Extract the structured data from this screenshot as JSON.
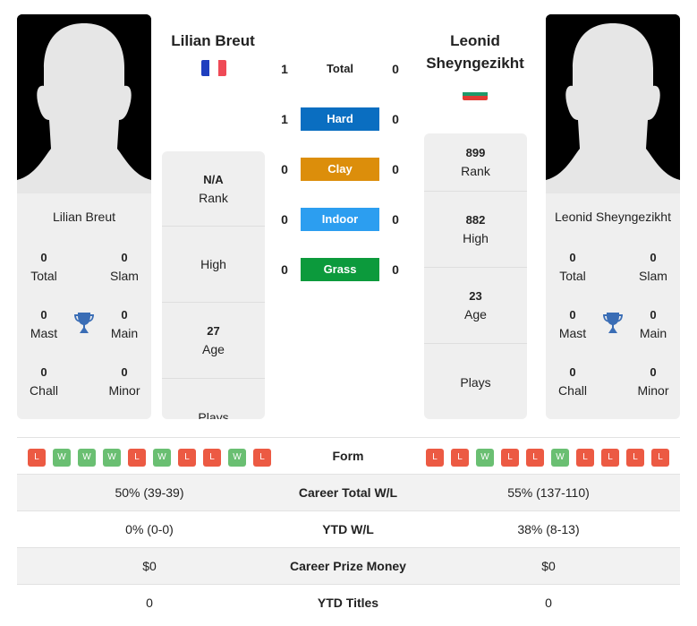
{
  "players": {
    "left": {
      "name": "Lilian Breut",
      "card_name": "Lilian Breut",
      "flag": "france",
      "flag_colors": [
        "#1f3fbf",
        "#ffffff",
        "#ef4a56"
      ],
      "titles": {
        "total": {
          "value": "0",
          "label": "Total"
        },
        "slam": {
          "value": "0",
          "label": "Slam"
        },
        "mast": {
          "value": "0",
          "label": "Mast"
        },
        "main": {
          "value": "0",
          "label": "Main"
        },
        "chall": {
          "value": "0",
          "label": "Chall"
        },
        "minor": {
          "value": "0",
          "label": "Minor"
        }
      },
      "stats": {
        "rank": {
          "value": "N/A",
          "label": "Rank"
        },
        "high": {
          "value": "",
          "label": "High"
        },
        "age": {
          "value": "27",
          "label": "Age"
        },
        "plays": {
          "value": "",
          "label": "Plays"
        }
      },
      "form": [
        "L",
        "W",
        "W",
        "W",
        "L",
        "W",
        "L",
        "L",
        "W",
        "L"
      ]
    },
    "right": {
      "name": "Leonid Sheyngezikht",
      "card_name": "Leonid Sheyngezikht",
      "flag": "bulgaria",
      "flag_colors": [
        "#ffffff",
        "#1e9a6a",
        "#e23b32"
      ],
      "titles": {
        "total": {
          "value": "0",
          "label": "Total"
        },
        "slam": {
          "value": "0",
          "label": "Slam"
        },
        "mast": {
          "value": "0",
          "label": "Mast"
        },
        "main": {
          "value": "0",
          "label": "Main"
        },
        "chall": {
          "value": "0",
          "label": "Chall"
        },
        "minor": {
          "value": "0",
          "label": "Minor"
        }
      },
      "stats": {
        "rank": {
          "value": "899",
          "label": "Rank"
        },
        "high": {
          "value": "882",
          "label": "High"
        },
        "age": {
          "value": "23",
          "label": "Age"
        },
        "plays": {
          "value": "",
          "label": "Plays"
        }
      },
      "form": [
        "L",
        "L",
        "W",
        "L",
        "L",
        "W",
        "L",
        "L",
        "L",
        "L"
      ]
    }
  },
  "h2h": [
    {
      "label": "Total",
      "left": "1",
      "right": "0",
      "color": ""
    },
    {
      "label": "Hard",
      "left": "1",
      "right": "0",
      "color": "#0a6ec1"
    },
    {
      "label": "Clay",
      "left": "0",
      "right": "0",
      "color": "#dc8e0b"
    },
    {
      "label": "Indoor",
      "left": "0",
      "right": "0",
      "color": "#2c9ef0"
    },
    {
      "label": "Grass",
      "left": "0",
      "right": "0",
      "color": "#0c9a3c"
    }
  ],
  "form_label": "Form",
  "comparison": [
    {
      "label": "Career Total W/L",
      "left": "50% (39-39)",
      "right": "55% (137-110)"
    },
    {
      "label": "YTD W/L",
      "left": "0% (0-0)",
      "right": "38% (8-13)"
    },
    {
      "label": "Career Prize Money",
      "left": "$0",
      "right": "$0"
    },
    {
      "label": "YTD Titles",
      "left": "0",
      "right": "0"
    }
  ],
  "icons": {
    "trophy": "trophy-icon",
    "silhouette": "player-silhouette"
  },
  "colors": {
    "trophy": "#3a6db5",
    "loss": "#ec5a43",
    "win": "#6abf72",
    "card_bg": "#efefef"
  }
}
